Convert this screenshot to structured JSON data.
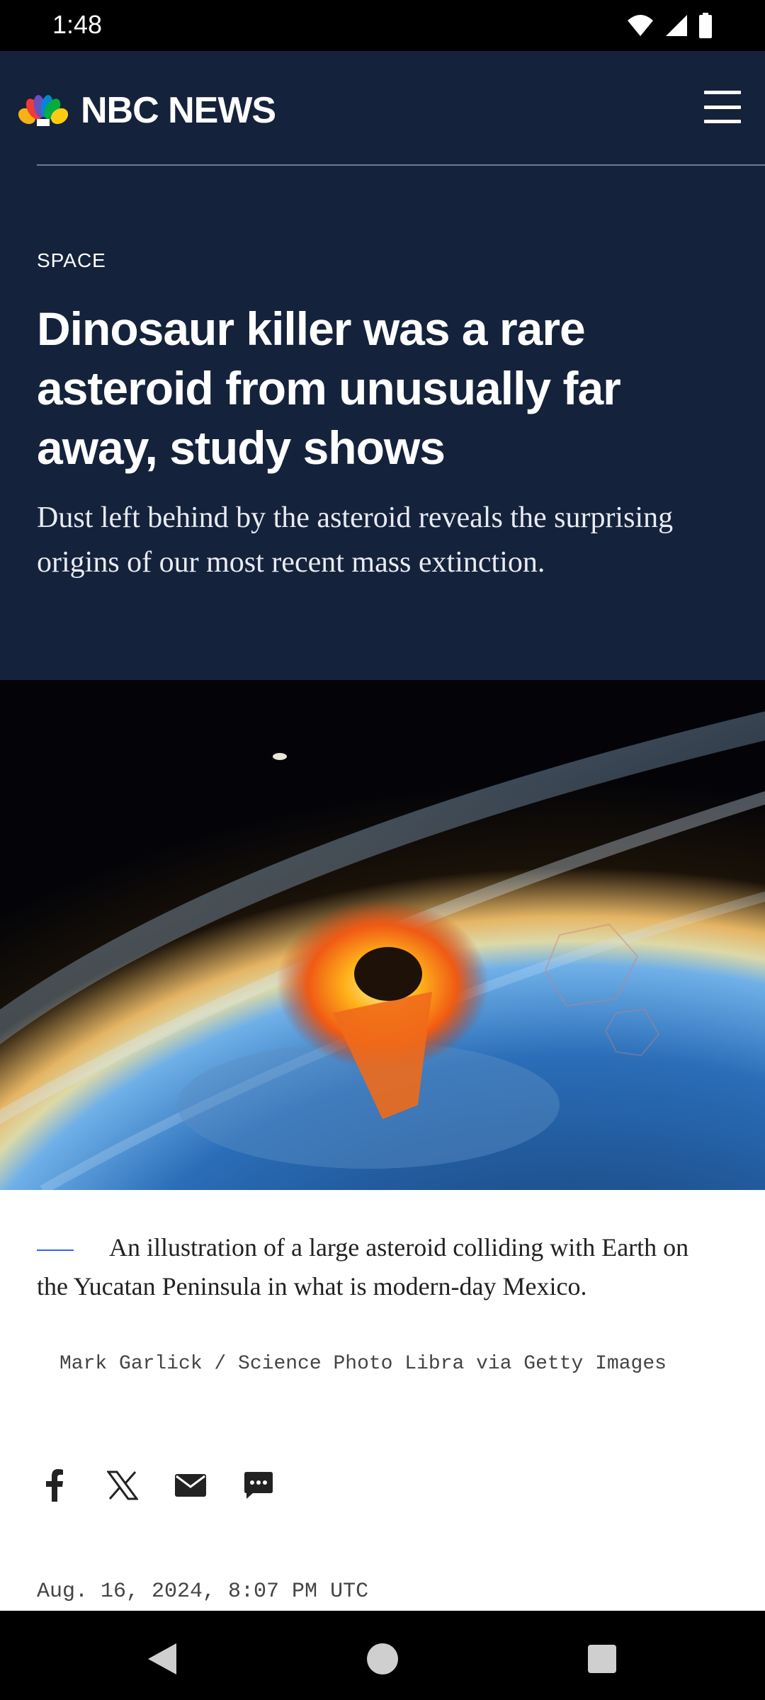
{
  "status_bar": {
    "time": "1:48",
    "icons": [
      "wifi-icon",
      "cell-signal-icon",
      "battery-icon"
    ]
  },
  "header": {
    "brand": "NBC NEWS",
    "menu_icon": "hamburger-menu-icon"
  },
  "article": {
    "section": "SPACE",
    "headline": "Dinosaur killer was a rare asteroid from unusually far away, study shows",
    "dek": "Dust left behind by the asteroid reveals the surprising origins of our most recent mass extinction.",
    "image_caption": "An illustration of a large asteroid colliding with Earth on the Yucatan Peninsula in what is modern-day Mexico.",
    "image_credit": "Mark Garlick / Science Photo Libra via Getty Images",
    "timestamp": "Aug. 16, 2024, 8:07 PM UTC"
  },
  "share": {
    "buttons": [
      "facebook-icon",
      "x-icon",
      "email-icon",
      "comments-icon"
    ]
  },
  "colors": {
    "header_bg": "#15223c",
    "caption_accent": "#3061ff"
  },
  "nav": {
    "buttons": [
      "back-icon",
      "home-icon",
      "recents-icon"
    ]
  }
}
